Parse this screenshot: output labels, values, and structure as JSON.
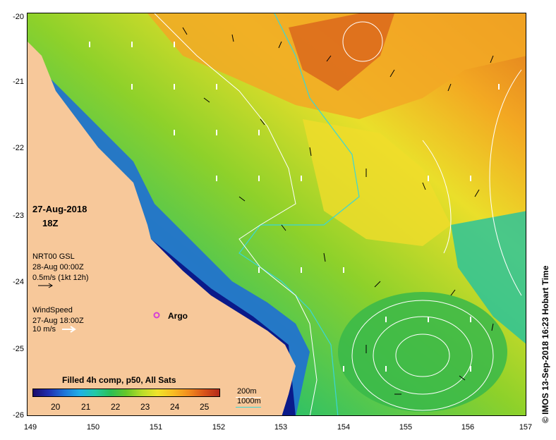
{
  "map": {
    "x_ticks": [
      "149",
      "150",
      "151",
      "152",
      "153",
      "154",
      "155",
      "156",
      "157"
    ],
    "y_ticks": [
      "-20",
      "-21",
      "-22",
      "-23",
      "-24",
      "-25",
      "-26"
    ],
    "colors": {
      "land": "#f7c89a",
      "deep_blue": "#0a1a8a",
      "isobath_1000": "#3ad6d6",
      "isobath_200": "#ffffff",
      "argo": "#d63fd6"
    }
  },
  "annotations": {
    "date": "27-Aug-2018",
    "time": "18Z",
    "current_source": "NRT00 GSL",
    "current_time": "28-Aug 00:00Z",
    "current_scale": "0.5m/s (1kt 12h)",
    "wind_label": "WindSpeed",
    "wind_time": "27-Aug 18:00Z",
    "wind_scale": "10 m/s",
    "argo_label": "Argo",
    "colorbar_title": "Filled 4h comp, p50, All Sats",
    "colorbar_ticks": [
      "20",
      "21",
      "22",
      "23",
      "24",
      "25"
    ],
    "isobath_200": "200m",
    "isobath_1000": "1000m",
    "copyright": "© IMOS 13-Sep-2018 16:23 Hobart Time"
  }
}
